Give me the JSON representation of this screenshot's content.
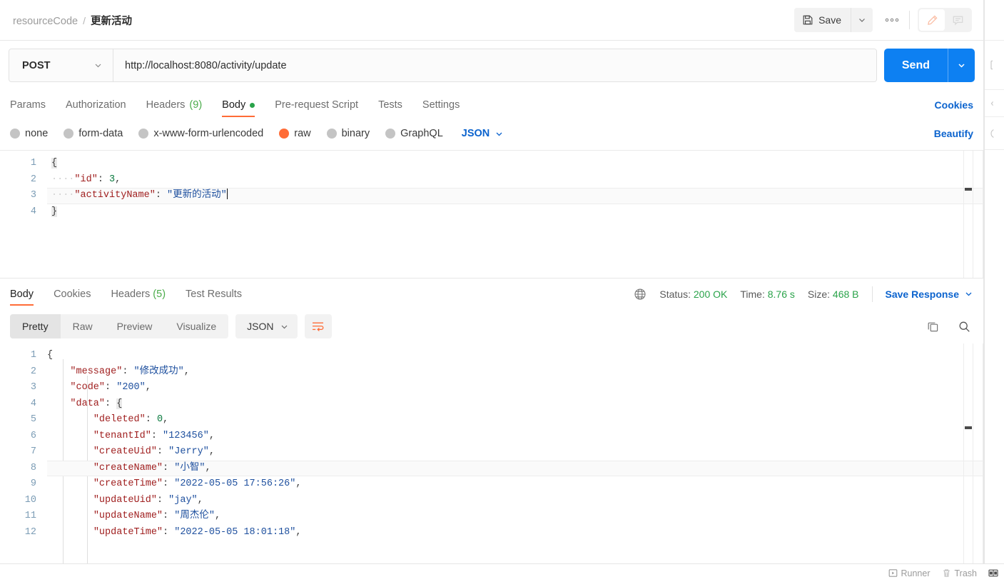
{
  "header": {
    "breadcrumb_root": "resourceCode",
    "breadcrumb_sep": "/",
    "breadcrumb_leaf": "更新活动",
    "save_label": "Save",
    "more_label": "●●●",
    "edit_icon": "pencil-icon",
    "comment_icon": "comment-icon"
  },
  "request": {
    "method": "POST",
    "url": "http://localhost:8080/activity/update",
    "send_label": "Send",
    "tabs": [
      {
        "label": "Params",
        "active": false
      },
      {
        "label": "Authorization",
        "active": false
      },
      {
        "label": "Headers",
        "count": "(9)",
        "active": false
      },
      {
        "label": "Body",
        "active": true,
        "dot": true
      },
      {
        "label": "Pre-request Script",
        "active": false
      },
      {
        "label": "Tests",
        "active": false
      },
      {
        "label": "Settings",
        "active": false
      }
    ],
    "cookies_link": "Cookies",
    "beautify_link": "Beautify",
    "body_types": [
      {
        "label": "none",
        "selected": false
      },
      {
        "label": "form-data",
        "selected": false
      },
      {
        "label": "x-www-form-urlencoded",
        "selected": false
      },
      {
        "label": "raw",
        "selected": true
      },
      {
        "label": "binary",
        "selected": false
      },
      {
        "label": "GraphQL",
        "selected": false
      }
    ],
    "raw_format": "JSON",
    "body_lines": [
      {
        "n": "1",
        "open_brace": true
      },
      {
        "n": "2",
        "indent": "····",
        "key": "\"id\"",
        "colon": ": ",
        "num": "3",
        "tail": ","
      },
      {
        "n": "3",
        "indent": "····",
        "key": "\"activityName\"",
        "colon": ": ",
        "str": "\"更新的活动\"",
        "caret": true,
        "highlight": true
      },
      {
        "n": "4",
        "close_brace": true
      }
    ]
  },
  "response": {
    "tabs": [
      {
        "label": "Body",
        "active": true
      },
      {
        "label": "Cookies",
        "active": false
      },
      {
        "label": "Headers",
        "count": "(5)",
        "active": false
      },
      {
        "label": "Test Results",
        "active": false
      }
    ],
    "status_label": "Status:",
    "status_value": "200 OK",
    "time_label": "Time:",
    "time_value": "8.76 s",
    "size_label": "Size:",
    "size_value": "468 B",
    "save_response": "Save Response",
    "view_modes": [
      {
        "label": "Pretty",
        "active": true
      },
      {
        "label": "Raw",
        "active": false
      },
      {
        "label": "Preview",
        "active": false
      },
      {
        "label": "Visualize",
        "active": false
      }
    ],
    "format": "JSON",
    "wrap_icon": "word-wrap-icon",
    "copy_icon": "copy-icon",
    "search_icon": "search-icon",
    "globe_icon": "globe-icon",
    "body_lines": [
      {
        "n": "1",
        "pad": "",
        "open_brace": true
      },
      {
        "n": "2",
        "pad": "    ",
        "key": "\"message\"",
        "colon": ": ",
        "str": "\"修改成功\"",
        "tail": ","
      },
      {
        "n": "3",
        "pad": "    ",
        "key": "\"code\"",
        "colon": ": ",
        "str": "\"200\"",
        "tail": ","
      },
      {
        "n": "4",
        "pad": "    ",
        "key": "\"data\"",
        "colon": ": ",
        "open_brace_inline": true
      },
      {
        "n": "5",
        "pad": "        ",
        "key": "\"deleted\"",
        "colon": ": ",
        "num": "0",
        "tail": ","
      },
      {
        "n": "6",
        "pad": "        ",
        "key": "\"tenantId\"",
        "colon": ": ",
        "str": "\"123456\"",
        "tail": ","
      },
      {
        "n": "7",
        "pad": "        ",
        "key": "\"createUid\"",
        "colon": ": ",
        "str": "\"Jerry\"",
        "tail": ","
      },
      {
        "n": "8",
        "pad": "        ",
        "key": "\"createName\"",
        "colon": ": ",
        "str": "\"小智\"",
        "tail": ",",
        "highlight": true
      },
      {
        "n": "9",
        "pad": "        ",
        "key": "\"createTime\"",
        "colon": ": ",
        "str": "\"2022-05-05 17:56:26\"",
        "tail": ","
      },
      {
        "n": "10",
        "pad": "        ",
        "key": "\"updateUid\"",
        "colon": ": ",
        "str": "\"jay\"",
        "tail": ","
      },
      {
        "n": "11",
        "pad": "        ",
        "key": "\"updateName\"",
        "colon": ": ",
        "str": "\"周杰伦\"",
        "tail": ","
      },
      {
        "n": "12",
        "pad": "        ",
        "key": "\"updateTime\"",
        "colon": ": ",
        "str": "\"2022-05-05 18:01:18\"",
        "tail": ","
      }
    ]
  },
  "statusbar": {
    "runner_label": "Runner",
    "trash_label": "Trash",
    "layout_icon": "panel-layout-icon"
  },
  "colors": {
    "accent": "#ff6c37",
    "send_blue": "#0d80f2",
    "link_blue": "#0b63ce",
    "status_green": "#2aa34a",
    "json_key": "#a02020",
    "json_string": "#1d4f9e",
    "json_number": "#0a7a3f"
  }
}
